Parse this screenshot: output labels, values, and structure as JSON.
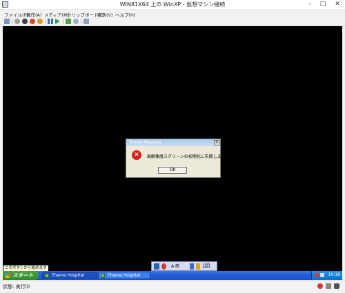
{
  "window": {
    "title": "WIN81X64 上の WinXP - 仮想マシン接続",
    "minimize": "–",
    "maximize": "□",
    "close": "✕"
  },
  "menu": [
    "ファイル(F)",
    "操作(A)",
    "メディア(M)",
    "クリップボード(C)",
    "表示(V)",
    "ヘルプ(H)"
  ],
  "toolbar_icons": [
    "ctrl-alt-del-icon",
    "start-icon",
    "turn-off-icon",
    "shutdown-icon",
    "save-state-icon",
    "pause-icon",
    "resume-icon",
    "checkpoint-icon",
    "revert-icon",
    "enhanced-session-icon"
  ],
  "dialog": {
    "title": "Theme Hospital",
    "close": "✕",
    "icon": "error-icon",
    "message": "高解像度スクリーンの初期化に失敗しました",
    "ok": "OK"
  },
  "tooltip": "このボタンから始めます",
  "langbar": {
    "mode": "A 般",
    "extra": "CAPS KANA"
  },
  "taskbar": {
    "start": "スタート",
    "buttons": [
      "Theme Hospital",
      "Theme Hospital"
    ],
    "clock": "10:18"
  },
  "status": {
    "label": "状態: 実行中"
  },
  "colors": {
    "accent_blue": "#245edc",
    "start_green": "#2f8a2a",
    "error_red": "#d6231d"
  }
}
